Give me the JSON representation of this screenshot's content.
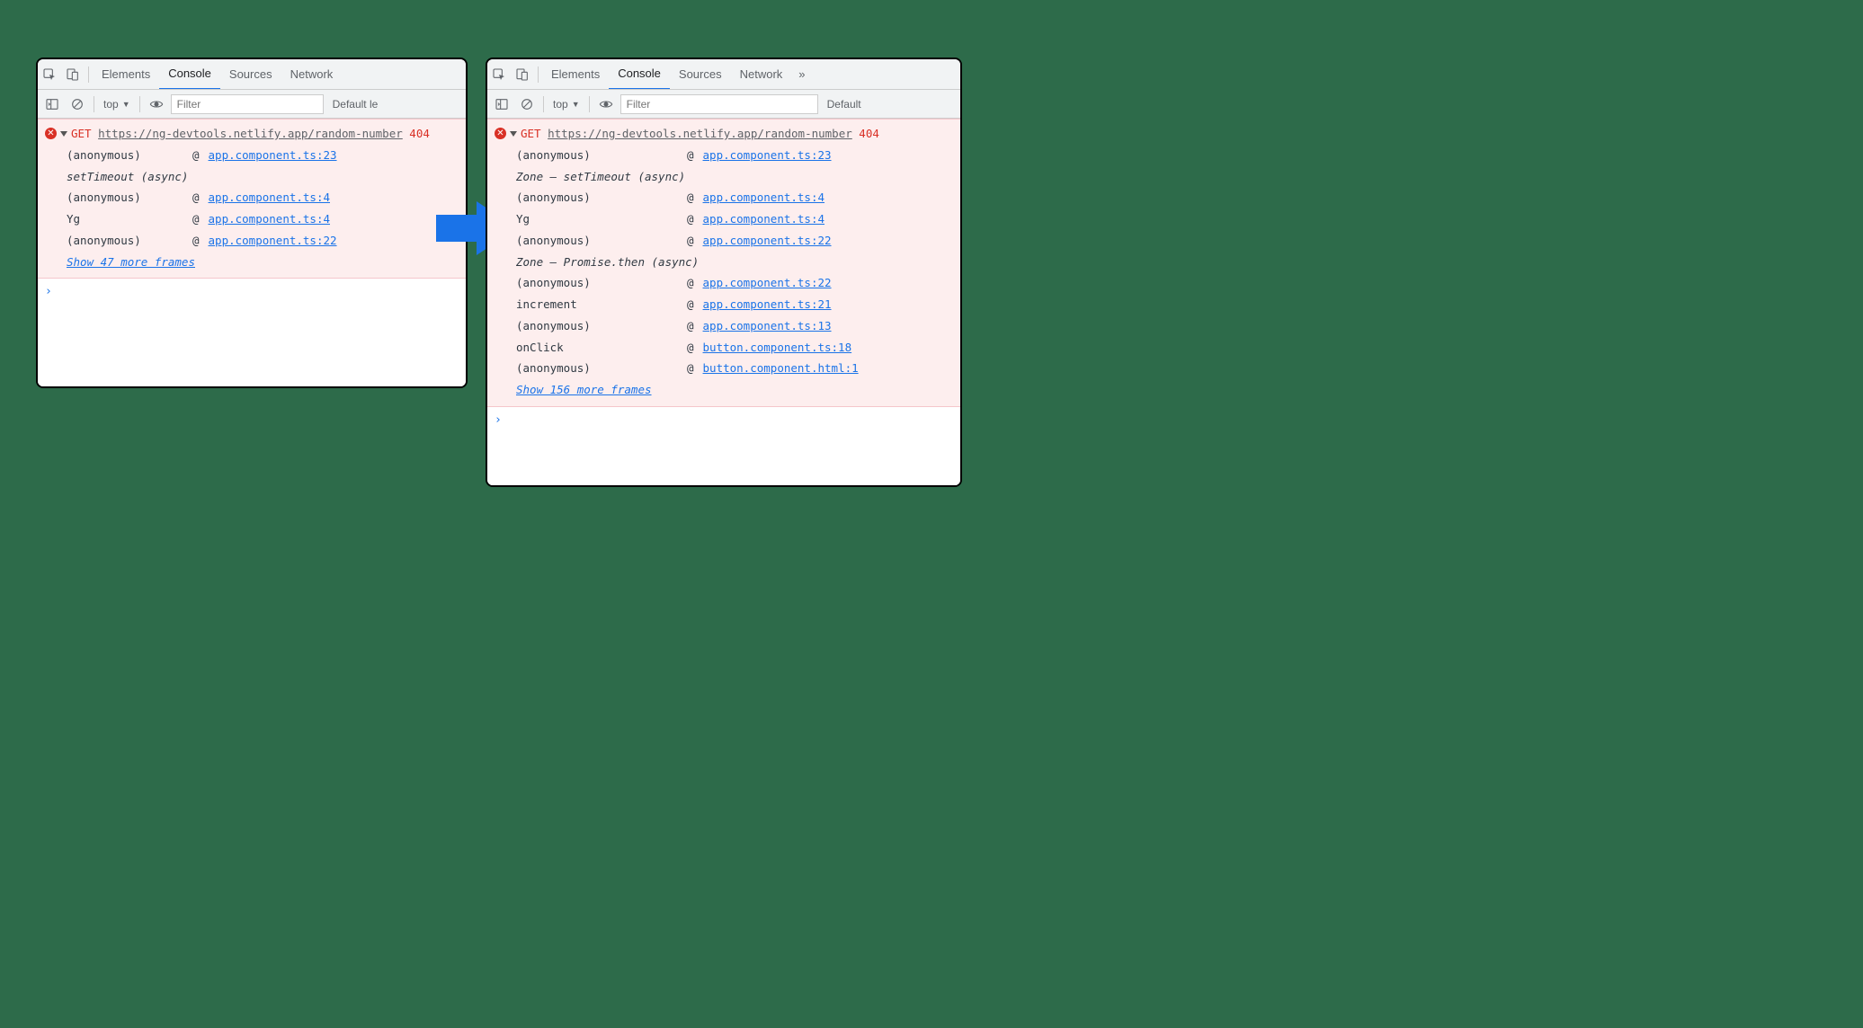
{
  "tabs": {
    "elements": "Elements",
    "console": "Console",
    "sources": "Sources",
    "network": "Network",
    "more": "»"
  },
  "toolbar": {
    "context": "top",
    "filter_placeholder": "Filter",
    "levels_left": "Default le",
    "levels_right": "Default"
  },
  "left": {
    "method": "GET",
    "url": "https://ng-devtools.netlify.app/random-number",
    "status": "404",
    "async1": "setTimeout (async)",
    "rows": [
      {
        "fn": "(anonymous)",
        "src": "app.component.ts:23"
      },
      {
        "fn": "(anonymous)",
        "src": "app.component.ts:4"
      },
      {
        "fn": "Yg",
        "src": "app.component.ts:4"
      },
      {
        "fn": "(anonymous)",
        "src": "app.component.ts:22"
      }
    ],
    "show_more": "Show 47 more frames"
  },
  "right": {
    "method": "GET",
    "url": "https://ng-devtools.netlify.app/random-number",
    "status": "404",
    "async1": "Zone — setTimeout (async)",
    "async2": "Zone — Promise.then (async)",
    "group1": [
      {
        "fn": "(anonymous)",
        "src": "app.component.ts:23"
      }
    ],
    "group2": [
      {
        "fn": "(anonymous)",
        "src": "app.component.ts:4"
      },
      {
        "fn": "Yg",
        "src": "app.component.ts:4"
      },
      {
        "fn": "(anonymous)",
        "src": "app.component.ts:22"
      }
    ],
    "group3": [
      {
        "fn": "(anonymous)",
        "src": "app.component.ts:22"
      },
      {
        "fn": "increment",
        "src": "app.component.ts:21"
      },
      {
        "fn": "(anonymous)",
        "src": "app.component.ts:13"
      },
      {
        "fn": "onClick",
        "src": "button.component.ts:18"
      },
      {
        "fn": "(anonymous)",
        "src": "button.component.html:1"
      }
    ],
    "show_more": "Show 156 more frames"
  },
  "at_symbol": "@",
  "prompt": "›"
}
